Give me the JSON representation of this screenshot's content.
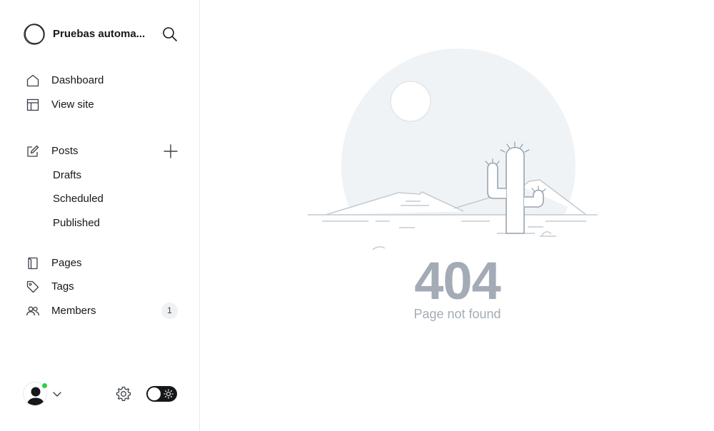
{
  "site": {
    "title": "Pruebas automa...",
    "logo_icon": "site-logo-circle"
  },
  "nav": {
    "dashboard": "Dashboard",
    "view_site": "View site",
    "posts": "Posts",
    "drafts": "Drafts",
    "scheduled": "Scheduled",
    "published": "Published",
    "pages": "Pages",
    "tags": "Tags",
    "members": "Members",
    "members_count": "1"
  },
  "icons": {
    "search": "search-icon",
    "home": "home-icon",
    "view_site": "layout-icon",
    "posts": "pencil-icon",
    "add": "plus-icon",
    "pages": "page-icon",
    "tags": "tag-icon",
    "members": "members-icon",
    "settings": "gear-icon",
    "theme": "sun-icon"
  },
  "user": {
    "status_color": "#30cf43"
  },
  "error": {
    "code": "404",
    "message": "Page not found"
  },
  "colors": {
    "text_primary": "#15171a",
    "error_text": "#a3acb6",
    "illustration_bg": "#eff3f6",
    "illustration_line": "#c4cbd2",
    "toggle_bg": "#15171a"
  }
}
